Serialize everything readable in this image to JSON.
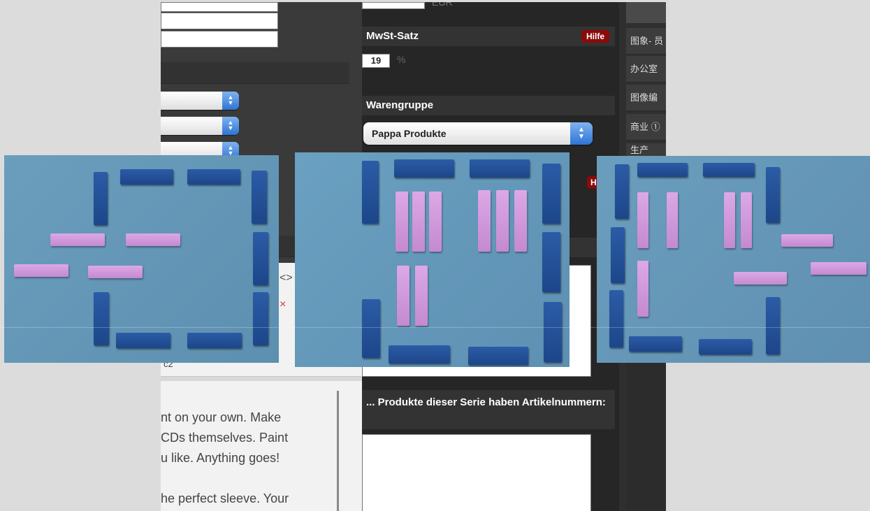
{
  "price": {
    "unit": "EUR"
  },
  "vat": {
    "title": "MwSt-Satz",
    "help": "Hilfe",
    "value": "19",
    "unit": "%"
  },
  "product_group": {
    "title": "Warengruppe",
    "selected": "Pappa Produkte",
    "help_partial": "Hi"
  },
  "series": {
    "title": "... Produkte dieser Serie haben Artikelnummern:"
  },
  "editor": {
    "tool_icon": "<>",
    "close_icon": "×",
    "subscript": "c2",
    "lines": [
      "nt on your own. Make",
      " CDs themselves. Paint",
      "u like. Anything goes!",
      "",
      "he perfect sleeve. Your"
    ]
  },
  "right_menu": {
    "items": [
      "图象- 员",
      "办公室",
      "图像编",
      "商业 ①",
      "生产"
    ]
  },
  "colors": {
    "panel_dark": "#2a2a2a",
    "help_red": "#8b0a0a",
    "stepper_blue": "#2e74d6",
    "stick_blue": "#1f4b90",
    "stick_pink": "#cf96da",
    "photo_bg": "#6a9cbc"
  },
  "photos": [
    {
      "name": "photo-1"
    },
    {
      "name": "photo-2"
    },
    {
      "name": "photo-3"
    }
  ]
}
